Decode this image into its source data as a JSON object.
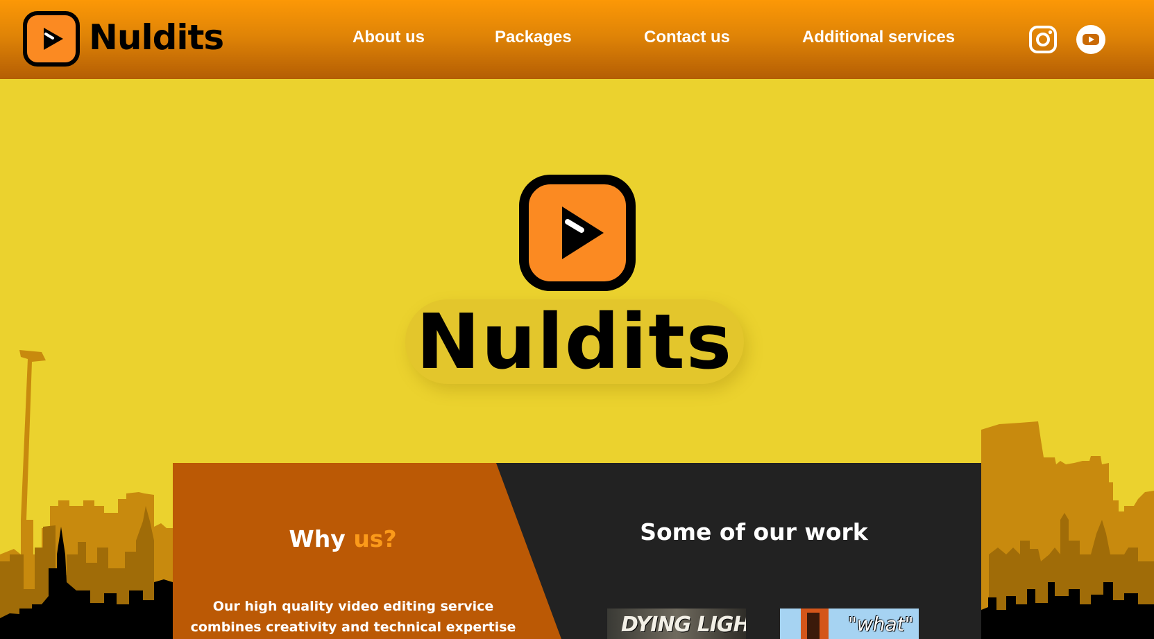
{
  "brand": {
    "name": "Nuldits",
    "accent_color": "#fb8a22",
    "logo_icon": "play-button-icon"
  },
  "nav": {
    "items": [
      {
        "label": "About us"
      },
      {
        "label": "Packages"
      },
      {
        "label": "Contact us"
      },
      {
        "label": "Additional services"
      }
    ]
  },
  "social": {
    "icons": [
      "instagram-icon",
      "youtube-icon"
    ]
  },
  "hero": {
    "wordmark": "Nuldits"
  },
  "why": {
    "title_main": "Why",
    "title_accent": "us?",
    "text_line_1": "Our high quality video editing service",
    "text_line_2": "combines creativity and technical expertise to"
  },
  "work": {
    "title": "Some of our work",
    "thumbnails": [
      {
        "text": "DYING LIGHT"
      },
      {
        "text": "\"what\""
      }
    ]
  },
  "colors": {
    "header_top": "#fc9806",
    "header_bottom": "#b45e04",
    "page_bg": "#ebd22e",
    "panel_orange": "#bb5905",
    "panel_dark": "#222222",
    "skyline_far": "#c88a0e",
    "skyline_near": "#000000"
  }
}
